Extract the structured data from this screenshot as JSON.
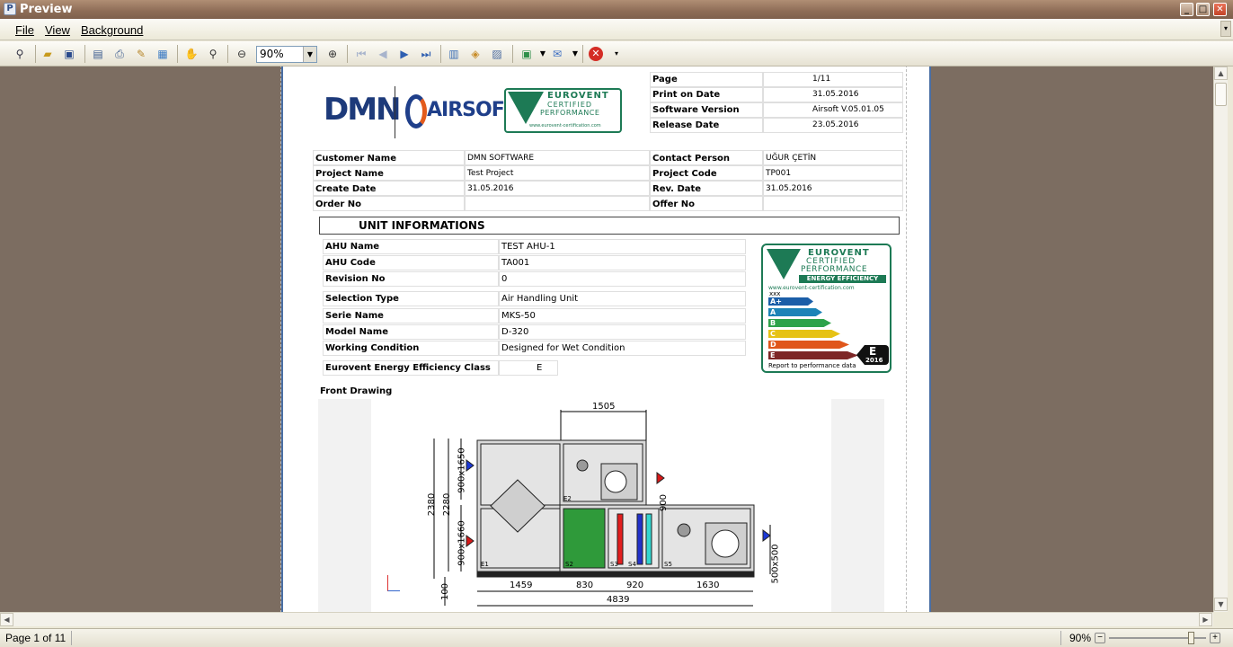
{
  "window": {
    "title": "Preview",
    "min": "_",
    "max": "□",
    "close": "✕"
  },
  "menu": {
    "items": [
      "File",
      "View",
      "Background"
    ]
  },
  "toolbar": {
    "zoom_value": "90%"
  },
  "status": {
    "page_text": "Page 1 of 11",
    "zoom_text": "90%",
    "zoom_slider_fraction": 0.85
  },
  "report": {
    "header_info": [
      {
        "label": "Page",
        "value": "1/11"
      },
      {
        "label": "Print on Date",
        "value": "31.05.2016"
      },
      {
        "label": "Software Version",
        "value": "Airsoft V.05.01.05"
      },
      {
        "label": "Release Date",
        "value": "23.05.2016"
      }
    ],
    "logo": {
      "dmn": "DMN",
      "airsoft": "AIRSOFT"
    },
    "eurovent": {
      "line1": "EUROVENT",
      "line2": "CERTIFIED",
      "line3": "PERFORMANCE",
      "site": "www.eurovent-certification.com",
      "ee": "ENERGY EFFICIENCY",
      "xxx": "xxx",
      "classes": [
        "A+",
        "A",
        "B",
        "C",
        "D",
        "E"
      ],
      "class_colors": [
        "#1b5ea8",
        "#1c83b7",
        "#2ea24a",
        "#e6c215",
        "#e0561b",
        "#7d2626"
      ],
      "selected": "E",
      "year": "2016",
      "footer": "Report to performance data"
    },
    "customer": [
      {
        "label": "Customer Name",
        "value": "DMN SOFTWARE",
        "label2": "Contact Person",
        "value2": "UĞUR ÇETİN"
      },
      {
        "label": "Project Name",
        "value": "Test Project",
        "label2": "Project Code",
        "value2": "TP001"
      },
      {
        "label": "Create Date",
        "value": "31.05.2016",
        "label2": "Rev. Date",
        "value2": "31.05.2016"
      },
      {
        "label": "Order No",
        "value": "",
        "label2": "Offer No",
        "value2": ""
      }
    ],
    "unit_title": "UNIT INFORMATIONS",
    "unit_rows": [
      {
        "label": "AHU Name",
        "value": "TEST AHU-1"
      },
      {
        "label": "AHU Code",
        "value": "TA001"
      },
      {
        "label": "Revision No",
        "value": "0"
      },
      {
        "label": "Selection Type",
        "value": "Air Handling Unit"
      },
      {
        "label": "Serie Name",
        "value": "MKS-50"
      },
      {
        "label": "Model Name",
        "value": "D-320"
      },
      {
        "label": "Working Condition",
        "value": "Designed for Wet Condition"
      }
    ],
    "ee_class": {
      "label": "Eurovent Energy Efficiency Class",
      "value": "E"
    },
    "front_drawing": {
      "title": "Front Drawing",
      "dims": {
        "top": "1505",
        "height_total": "2380",
        "height_inner": "2280",
        "upper": "900x1650",
        "lower": "900x1660",
        "side": "500x500",
        "mid": "900",
        "base": "100",
        "w1": "1459",
        "w2": "830",
        "w3": "920",
        "w4": "1630",
        "total": "4839"
      },
      "sections": [
        "E1",
        "E2",
        "S2",
        "S3",
        "S4",
        "S5"
      ]
    }
  }
}
